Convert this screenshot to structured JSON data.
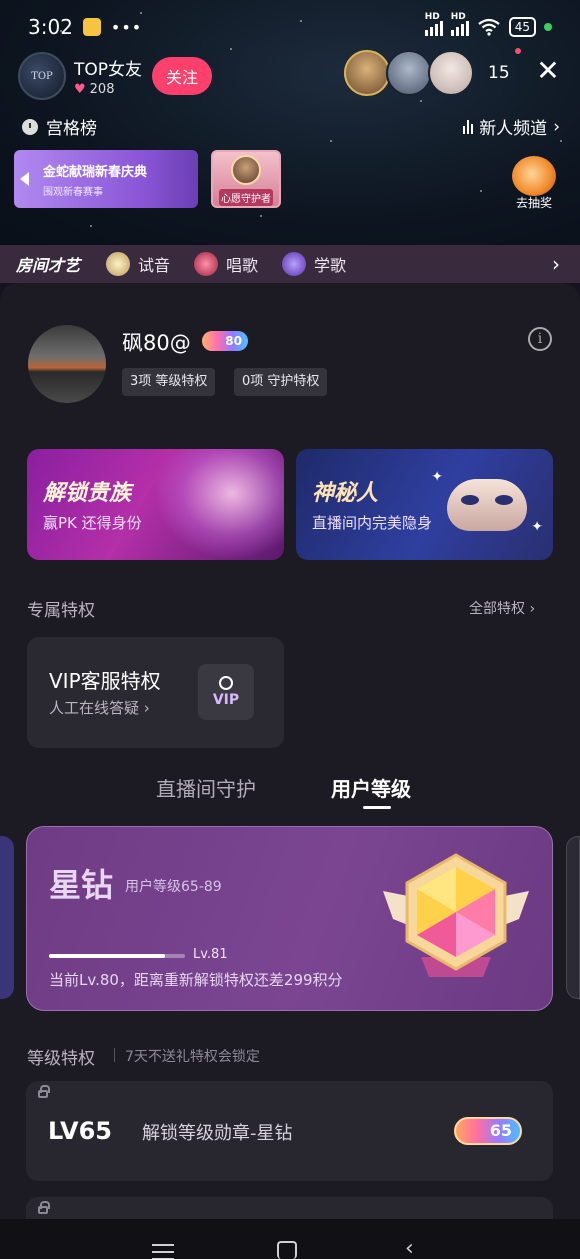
{
  "status_bar": {
    "time": "3:02",
    "dots": "•••",
    "battery": "45",
    "hd1": "HD",
    "hd2": "HD"
  },
  "anchor": {
    "avatar_text": "TOP",
    "name": "TOP女友",
    "likes": "208",
    "follow_label": "关注"
  },
  "viewers": {
    "count": "15"
  },
  "rank": {
    "label": "宫格榜",
    "channel": "新人频道",
    "channel_arrow": "›"
  },
  "banners": {
    "festival_title": "金蛇献瑞新春庆典",
    "festival_sub": "围观新春赛事",
    "guardian_label": "心愿守护者",
    "lottery_label": "去抽奖"
  },
  "talent": {
    "title": "房间才艺",
    "items": [
      "试音",
      "唱歌",
      "学歌"
    ],
    "arrow": "›"
  },
  "user": {
    "name": "砜80@",
    "level": "80",
    "chip_level": "3项 等级特权",
    "chip_guard": "0项 守护特权",
    "info": "i"
  },
  "promos": {
    "noble_title": "解锁贵族",
    "noble_sub": "赢PK 还得身份",
    "mystery_title": "神秘人",
    "mystery_sub": "直播间内完美隐身"
  },
  "exclusive": {
    "title": "专属特权",
    "all_label": "全部特权 ›"
  },
  "vip": {
    "title": "VIP客服特权",
    "sub": "人工在线答疑 ›",
    "icon_text": "VIP"
  },
  "tabs": {
    "guard": "直播间守护",
    "level": "用户等级"
  },
  "level_card": {
    "title": "星钻",
    "range": "用户等级65-89",
    "next_level": "Lv.81",
    "progress": 0.85,
    "note": "当前Lv.80，距离重新解锁特权还差299积分"
  },
  "level_priv": {
    "title": "等级特权",
    "lock_note": "7天不送礼特权会锁定"
  },
  "priv_rows": [
    {
      "lv": "LV65",
      "desc": "解锁等级勋章-星钻",
      "badge": "65"
    }
  ],
  "nav": {
    "back": "‹"
  },
  "colors": {
    "follow": "#ff3f6c",
    "sheet": "#1c1a22",
    "level_card": "#7b4592"
  }
}
